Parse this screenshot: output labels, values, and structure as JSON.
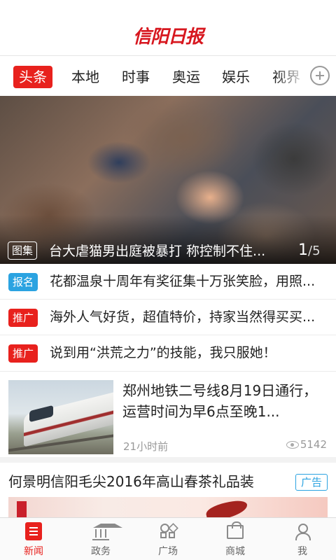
{
  "header": {
    "logo_text": "信阳日报"
  },
  "tabs": [
    {
      "label": "头条",
      "active": true
    },
    {
      "label": "本地"
    },
    {
      "label": "时事"
    },
    {
      "label": "奥运"
    },
    {
      "label": "娱乐"
    },
    {
      "label": "视界"
    }
  ],
  "hero": {
    "tag": "图集",
    "title": "台大虐猫男出庭被暴打 称控制不住...",
    "pager_current": "1",
    "pager_total": "/5"
  },
  "briefs": [
    {
      "badge": "报名",
      "badge_color": "#2ba3e1",
      "text": "花都温泉十周年有奖征集十万张笑脸，用照..."
    },
    {
      "badge": "推广",
      "badge_color": "#e8211d",
      "text": "海外人气好货，超值特价，持家当然得买买..."
    },
    {
      "badge": "推广",
      "badge_color": "#e8211d",
      "text": "说到用“洪荒之力”的技能，我只服她！"
    }
  ],
  "news": {
    "title": "郑州地铁二号线8月19日通行，运营时间为早6点至晚1...",
    "time": "21小时前",
    "views": "5142"
  },
  "ad": {
    "title": "何景明信阳毛尖2016年高山春茶礼品装",
    "badge": "广告"
  },
  "tabbar": [
    {
      "label": "新闻",
      "icon": "newspaper-icon",
      "active": true
    },
    {
      "label": "政务",
      "icon": "government-icon"
    },
    {
      "label": "广场",
      "icon": "square-grid-icon"
    },
    {
      "label": "商城",
      "icon": "shopping-bag-icon"
    },
    {
      "label": "我",
      "icon": "user-icon"
    }
  ],
  "colors": {
    "accent": "#e8211d",
    "blue": "#2ba3e1"
  }
}
